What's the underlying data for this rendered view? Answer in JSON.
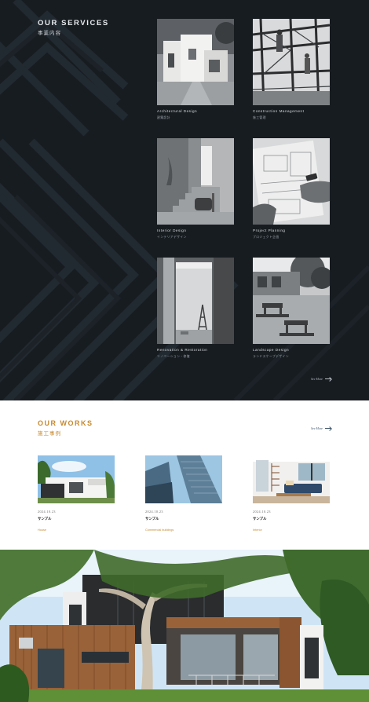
{
  "services": {
    "title": "OUR SERVICES",
    "subtitle": "事業内容",
    "items": [
      {
        "en": "Architectural Design",
        "jp": "建築設計",
        "image": "white-modern-house-photo"
      },
      {
        "en": "Construction Management",
        "jp": "施工管理",
        "image": "steel-framework-workers-photo"
      },
      {
        "en": "Interior Design",
        "jp": "インテリアデザイン",
        "image": "minimal-interior-stairs-photo"
      },
      {
        "en": "Project Planning",
        "jp": "プロジェクト企画",
        "image": "blueprint-planning-photo"
      },
      {
        "en": "Renovation & Restoration",
        "jp": "リノベーション・修復",
        "image": "renovation-room-ladder-photo"
      },
      {
        "en": "Landscape Design",
        "jp": "ランドスケープデザイン",
        "image": "garden-patio-tables-photo"
      }
    ],
    "more_label": "See More"
  },
  "works": {
    "title": "OUR WORKS",
    "subtitle": "施工事例",
    "more_label": "See More",
    "items": [
      {
        "date": "2024.10.23",
        "name": "サンプル",
        "tag": "House",
        "image": "modern-white-house-photo"
      },
      {
        "date": "2024.10.23",
        "name": "サンプル",
        "tag": "Commercial buildings",
        "image": "glass-office-tower-photo"
      },
      {
        "date": "2024.10.23",
        "name": "サンプル",
        "tag": "Interior",
        "image": "bright-living-room-photo"
      }
    ]
  },
  "hero": {
    "image": "timber-clad-modern-house-photo"
  },
  "colors": {
    "dark_bg": "#171c21",
    "accent": "#c7892e",
    "navy_link": "#3d5468"
  }
}
